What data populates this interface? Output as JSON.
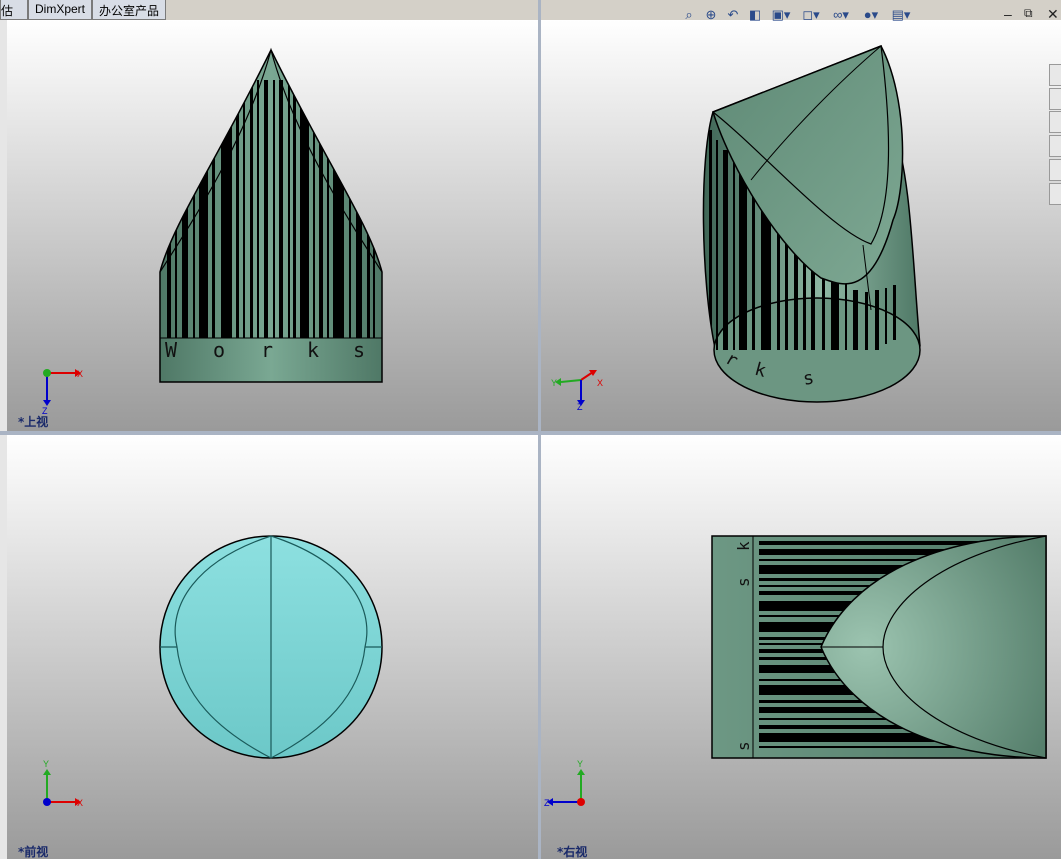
{
  "tabs": [
    "估",
    "DimXpert",
    "办公室产品"
  ],
  "viewports": {
    "top": "*上视",
    "front": "*前视",
    "right": "*右视"
  },
  "model_text": {
    "top_letters": [
      "W",
      "o",
      "r",
      "k",
      "s"
    ],
    "iso_letters": [
      "r",
      "k",
      "s"
    ],
    "right_letters": [
      "k",
      "s",
      "s"
    ]
  },
  "triad_labels": {
    "top": {
      "x": "X",
      "z": "Z"
    },
    "iso": {
      "x": "X",
      "y": "Y",
      "z": "Z"
    },
    "front": {
      "x": "X",
      "y": "Y"
    },
    "right": {
      "y": "Y",
      "z": "Z"
    }
  },
  "toolbar_icons": [
    "zoom-to-fit-icon",
    "zoom-area-icon",
    "previous-view-icon",
    "section-view-icon",
    "view-orientation-icon",
    "display-style-icon",
    "hide-show-icon",
    "appearance-icon",
    "scene-icon"
  ],
  "window_controls": {
    "minimize": "–",
    "restore": "🗗",
    "close": "✕"
  },
  "colors": {
    "model_green": "#5f8a76",
    "model_cyan": "#7fd8d8",
    "barcode": "#000000"
  }
}
